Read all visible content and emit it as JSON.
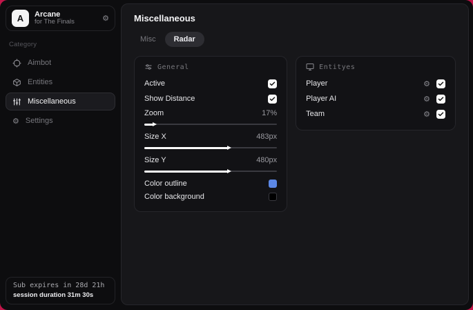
{
  "sidebar": {
    "brand": {
      "initial": "A",
      "name": "Arcane",
      "subtitle": "for The Finals",
      "gear_icon": "gear-icon"
    },
    "category_label": "Category",
    "items": [
      {
        "label": "Aimbot",
        "icon": "crosshair-icon",
        "selected": false
      },
      {
        "label": "Entities",
        "icon": "cube-icon",
        "selected": false
      },
      {
        "label": "Miscellaneous",
        "icon": "sliders-vertical-icon",
        "selected": true
      },
      {
        "label": "Settings",
        "icon": "gear-icon",
        "selected": false
      }
    ],
    "footer": {
      "line1": "Sub expires in 28d 21h",
      "line2": "session duration 31m 30s"
    }
  },
  "main": {
    "title": "Miscellaneous",
    "tabs": [
      {
        "label": "Misc",
        "active": false
      },
      {
        "label": "Radar",
        "active": true
      }
    ],
    "general": {
      "header": "General",
      "header_icon": "sliders-horizontal-icon",
      "toggles": [
        {
          "label": "Active",
          "checked": true
        },
        {
          "label": "Show Distance",
          "checked": true
        }
      ],
      "sliders": [
        {
          "label": "Zoom",
          "value": "17%",
          "percent": 7
        },
        {
          "label": "Size X",
          "value": "483px",
          "percent": 63
        },
        {
          "label": "Size Y",
          "value": "480px",
          "percent": 63
        }
      ],
      "colors": [
        {
          "label": "Color outline",
          "color": "#5b87e5"
        },
        {
          "label": "Color background",
          "color": "#000000"
        }
      ]
    },
    "entities": {
      "header": "Entityes",
      "header_icon": "monitor-icon",
      "rows": [
        {
          "label": "Player",
          "checked": true,
          "gear_icon": "gear-icon"
        },
        {
          "label": "Player AI",
          "checked": true,
          "gear_icon": "gear-icon"
        },
        {
          "label": "Team",
          "checked": true,
          "gear_icon": "gear-icon"
        }
      ]
    }
  },
  "colors": {
    "backdrop_red": "#c2164a",
    "swatch_blue": "#5b87e5",
    "swatch_black": "#000000"
  }
}
